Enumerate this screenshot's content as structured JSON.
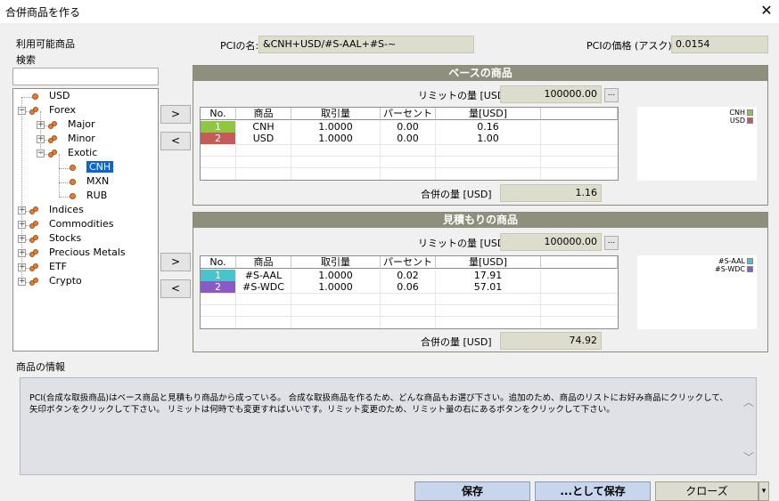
{
  "window": {
    "title": "合併商品を作る",
    "close_glyph": "✕"
  },
  "left": {
    "available_label": "利用可能商品",
    "search_label": "検索",
    "search_value": "",
    "tree": [
      {
        "label": "USD",
        "level": 0,
        "kind": "leaf"
      },
      {
        "label": "Forex",
        "level": 0,
        "kind": "group",
        "expander": "⊟"
      },
      {
        "label": "Major",
        "level": 1,
        "kind": "group",
        "expander": "⊞"
      },
      {
        "label": "Minor",
        "level": 1,
        "kind": "group",
        "expander": "⊞"
      },
      {
        "label": "Exotic",
        "level": 1,
        "kind": "group",
        "expander": "⊟"
      },
      {
        "label": "CNH",
        "level": 2,
        "kind": "leaf",
        "selected": true
      },
      {
        "label": "MXN",
        "level": 2,
        "kind": "leaf"
      },
      {
        "label": "RUB",
        "level": 2,
        "kind": "leaf"
      },
      {
        "label": "Indices",
        "level": 0,
        "kind": "group",
        "expander": "⊞"
      },
      {
        "label": "Commodities",
        "level": 0,
        "kind": "group",
        "expander": "⊞"
      },
      {
        "label": "Stocks",
        "level": 0,
        "kind": "group",
        "expander": "⊞"
      },
      {
        "label": "Precious Metals",
        "level": 0,
        "kind": "group",
        "expander": "⊞"
      },
      {
        "label": "ETF",
        "level": 0,
        "kind": "group",
        "expander": "⊞"
      },
      {
        "label": "Crypto",
        "level": 0,
        "kind": "group",
        "expander": "⊞"
      }
    ]
  },
  "header": {
    "pci_name_label": "PCIの名:",
    "pci_name_value": "&CNH+USD/#S-AAL+#S-~",
    "pci_price_label": "PCIの価格 (アスク):",
    "pci_price_value": "0.0154"
  },
  "arrows": {
    "add": ">",
    "remove": "<"
  },
  "base": {
    "title": "ベースの商品",
    "limit_label": "リミットの量 [USD]",
    "limit_value": "100000.00",
    "dots_button": "...",
    "columns": [
      "No.",
      "商品",
      "取引量",
      "パーセント",
      "量[USD]"
    ],
    "rows": [
      {
        "no": "1",
        "symbol": "CNH",
        "volume": "1.0000",
        "percent": "0.00",
        "amount": "0.16",
        "color": "#8ec63f"
      },
      {
        "no": "2",
        "symbol": "USD",
        "volume": "1.0000",
        "percent": "0.00",
        "amount": "1.00",
        "color": "#c65a5a"
      }
    ],
    "total_label": "合併の量 [USD]",
    "total_value": "1.16",
    "legend": [
      {
        "name": "CNH",
        "color": "#8ec63f"
      },
      {
        "name": "USD",
        "color": "#c65a5a"
      }
    ]
  },
  "quote": {
    "title": "見積もりの商品",
    "limit_label": "リミットの量 [USD]",
    "limit_value": "100000.00",
    "dots_button": "...",
    "columns": [
      "No.",
      "商品",
      "取引量",
      "パーセント",
      "量[USD]"
    ],
    "rows": [
      {
        "no": "1",
        "symbol": "#S-AAL",
        "volume": "1.0000",
        "percent": "0.02",
        "amount": "17.91",
        "color": "#47c4cc"
      },
      {
        "no": "2",
        "symbol": "#S-WDC",
        "volume": "1.0000",
        "percent": "0.06",
        "amount": "57.01",
        "color": "#8a5ac6"
      }
    ],
    "total_label": "合併の量 [USD]",
    "total_value": "74.92",
    "legend": [
      {
        "name": "#S-AAL",
        "color": "#47c4cc"
      },
      {
        "name": "#S-WDC",
        "color": "#8a5ac6"
      }
    ]
  },
  "info": {
    "label": "商品の情報",
    "text": "PCI(合成な取扱商品)はベース商品と見積もり商品から成っている。 合成な取扱商品を作るため、どんな商品もお選び下さい。追加のため、商品のリストにお好み商品にクリックして、矢印ボタンをクリックして下さい。 リミットは何時でも変更すればいいです。リミット変更のため、リミット量の右にあるボタンをクリックして下さい。"
  },
  "buttons": {
    "save": "保存",
    "save_as": "...として保存",
    "close": "クローズ",
    "dropdown_glyph": "▾"
  }
}
